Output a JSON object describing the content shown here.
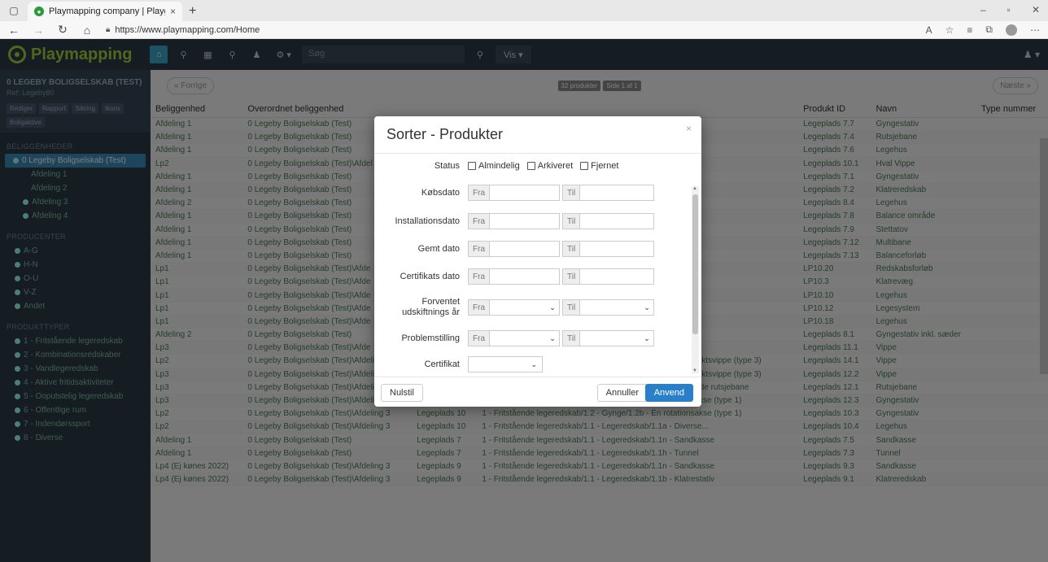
{
  "browser": {
    "tab_title": "Playmapping company | Playgro",
    "tab_close": "×",
    "new_tab": "+",
    "url": "https://www.playmapping.com/Home"
  },
  "app": {
    "logo": "Playmapping",
    "search_placeholder": "Søg",
    "vis_label": "Vis ▾"
  },
  "sidebar": {
    "company_name": "0 LEGEBY BOLIGSELSKAB (TEST)",
    "company_ref": "Ref: Legeby80",
    "buttons": [
      "Rediger",
      "Rapport",
      "Sikring",
      "Ikons",
      "Boligaktive"
    ],
    "sections": {
      "beliggenhed": "BELIGGENHEDER",
      "producenter": "PRODUCENTER",
      "produkttyper": "PRODUKTTYPER"
    },
    "locations": [
      "0 Legeby Boligselskab (Test)",
      "Afdeling 1",
      "Afdeling 2",
      "Afdeling 3",
      "Afdeling 4"
    ],
    "producers": [
      "A-G",
      "H-N",
      "O-U",
      "V-Z",
      "Andet"
    ],
    "product_types": [
      "1 - Fritstående legeredskab",
      "2 - Kombinationsredskaber",
      "3 - Vandlegeredskab",
      "4 - Aktive fritidsaktiviteter",
      "5 - Ooputstelig legeredskab",
      "6 - Offentlige rum",
      "7 - Indendørssport",
      "8 - Diverse"
    ]
  },
  "pager": {
    "prev": "« Forrige",
    "next": "Næste »",
    "badge_count": "32 produkter",
    "badge_page": "Side 1 af 1"
  },
  "table": {
    "headers": [
      "Beliggenhed",
      "Overordnet beliggenhed",
      "",
      "",
      "Produkt ID",
      "Navn",
      "Type nummer"
    ],
    "rows": [
      [
        "Afdeling 1",
        "0 Legeby Boligselskab (Test)",
        "",
        "rotationsakse (type 1)",
        "Legeplads 7.7",
        "Gyngestativ",
        ""
      ],
      [
        "Afdeling 1",
        "0 Legeby Boligselskab (Test)",
        "",
        "Tentamrutsjebane",
        "Legeplads 7.4",
        "Rutsjebane",
        ""
      ],
      [
        "Afdeling 1",
        "0 Legeby Boligselskab (Test)",
        "",
        "- Diverse...",
        "Legeplads 7.6",
        "Legehus",
        ""
      ],
      [
        "Lp2",
        "0 Legeby Boligselskab (Test)\\Afdel",
        "",
        "c - Etpunktsvippe (type 2)",
        "Legeplads 10.1",
        "Hval Vippe",
        ""
      ],
      [
        "Afdeling 1",
        "0 Legeby Boligselskab (Test)",
        "",
        "rotationsakse (type 1)",
        "Legeplads 7.1",
        "Gyngestativ",
        ""
      ],
      [
        "Afdeling 1",
        "0 Legeby Boligselskab (Test)",
        "",
        "- Klatrestativ",
        "Legeplads 7.2",
        "Klatreredskab",
        ""
      ],
      [
        "Afdeling 2",
        "0 Legeby Boligselskab (Test)",
        "",
        "- Diverse...",
        "Legeplads 8.4",
        "Legehus",
        ""
      ],
      [
        "Afdeling 1",
        "0 Legeby Boligselskab (Test)",
        "",
        "- Balanceredskab",
        "Legeplads 7.8",
        "Balance område",
        ""
      ],
      [
        "Afdeling 1",
        "0 Legeby Boligselskab (Test)",
        "",
        "",
        "Legeplads 7.9",
        "Stettatov",
        ""
      ],
      [
        "Afdeling 1",
        "0 Legeby Boligselskab (Test)",
        "",
        "ebane",
        "Legeplads 7.12",
        "Multibane",
        ""
      ],
      [
        "Afdeling 1",
        "0 Legeby Boligselskab (Test)",
        "",
        "",
        "Legeplads 7.13",
        "Balanceforløb",
        ""
      ],
      [
        "Lp1",
        "0 Legeby Boligselskab (Test)\\Afde",
        "",
        "",
        "LP10.20",
        "Redskabsforløb",
        ""
      ],
      [
        "Lp1",
        "0 Legeby Boligselskab (Test)\\Afde",
        "",
        "- Klatrevæg",
        "LP10.3",
        "Klatrevæg",
        ""
      ],
      [
        "Lp1",
        "0 Legeby Boligselskab (Test)\\Afde",
        "",
        "- Diverse...",
        "LP10.10",
        "Legehus",
        ""
      ],
      [
        "Lp1",
        "0 Legeby Boligselskab (Test)\\Afde",
        "",
        "",
        "LP10.12",
        "Legesystem",
        ""
      ],
      [
        "Lp1",
        "0 Legeby Boligselskab (Test)\\Afde",
        "",
        "- Diverse...",
        "LP10.18",
        "Legehus",
        ""
      ],
      [
        "Afdeling 2",
        "0 Legeby Boligselskab (Test)",
        "",
        "",
        "Legeplads 8.1",
        "Gyngestativ inkl. sæder",
        ""
      ],
      [
        "Lp3",
        "0 Legeby Boligselskab (Test)\\Afde",
        "",
        "- Etpunktsvippe (type 2)",
        "Legeplads 11.1",
        "Vippe",
        ""
      ],
      [
        "Lp2",
        "0 Legeby Boligselskab (Test)\\Afdeling 4",
        "Legeplads 14",
        "1 - Fritstående legeredskab/1.6 - Vippeedskab/1.6d - Flerpunktsvippe (type 3)",
        "Legeplads 14.1",
        "Vippe",
        ""
      ],
      [
        "Lp3",
        "0 Legeby Boligselskab (Test)\\Afdeling 4",
        "Legeplads 12",
        "1 - Fritstående legeredskab/1.6 - Vippeedskab/1.6d - Flerpunktsvippe (type 3)",
        "Legeplads 12.2",
        "Vippe",
        ""
      ],
      [
        "Lp3",
        "0 Legeby Boligselskab (Test)\\Afdeling 4",
        "Legeplads 12",
        "1 - Fritstående legeredskab/1.3 - Rutsjebane/1.3c - Fritstående rutsjebane",
        "Legeplads 12.1",
        "Rutsjebane",
        ""
      ],
      [
        "Lp3",
        "0 Legeby Boligselskab (Test)\\Afdeling 4",
        "Legeplads 12",
        "1 - Fritstående legeredskab/1.2 - Gynge/1.2b - Én rotationsakse (type 1)",
        "Legeplads 12.3",
        "Gyngestativ",
        ""
      ],
      [
        "Lp2",
        "0 Legeby Boligselskab (Test)\\Afdeling 3",
        "Legeplads 10",
        "1 - Fritstående legeredskab/1.2 - Gynge/1.2b - Én rotationsakse (type 1)",
        "Legeplads 10.3",
        "Gyngestativ",
        ""
      ],
      [
        "Lp2",
        "0 Legeby Boligselskab (Test)\\Afdeling 3",
        "Legeplads 10",
        "1 - Fritstående legeredskab/1.1 - Legeredskab/1.1a - Diverse...",
        "Legeplads 10.4",
        "Legehus",
        ""
      ],
      [
        "Afdeling 1",
        "0 Legeby Boligselskab (Test)",
        "Legeplads 7",
        "1 - Fritstående legeredskab/1.1 - Legeredskab/1.1n - Sandkasse",
        "Legeplads 7.5",
        "Sandkasse",
        ""
      ],
      [
        "Afdeling 1",
        "0 Legeby Boligselskab (Test)",
        "Legeplads 7",
        "1 - Fritstående legeredskab/1.1 - Legeredskab/1.1h - Tunnel",
        "Legeplads 7.3",
        "Tunnel",
        ""
      ],
      [
        "Lp4 (Ej kønes 2022)",
        "0 Legeby Boligselskab (Test)\\Afdeling 3",
        "Legeplads 9",
        "1 - Fritstående legeredskab/1.1 - Legeredskab/1.1n - Sandkasse",
        "Legeplads 9.3",
        "Sandkasse",
        ""
      ],
      [
        "Lp4 (Ej kønes 2022)",
        "0 Legeby Boligselskab (Test)\\Afdeling 3",
        "Legeplads 9",
        "1 - Fritstående legeredskab/1.1 - Legeredskab/1.1b - Klatrestativ",
        "Legeplads 9.1",
        "Klatreredskab",
        ""
      ]
    ]
  },
  "modal": {
    "title": "Sorter - Produkter",
    "close": "×",
    "status_label": "Status",
    "status_options": [
      "Almindelig",
      "Arkiveret",
      "Fjernet"
    ],
    "date_rows": [
      {
        "label": "Købsdato",
        "type": "date"
      },
      {
        "label": "Installationsdato",
        "type": "date"
      },
      {
        "label": "Gemt dato",
        "type": "date"
      },
      {
        "label": "Certifikats dato",
        "type": "date"
      }
    ],
    "select_rows": [
      {
        "label": "Forventet udskiftnings år"
      },
      {
        "label": "Problemstilling"
      }
    ],
    "from": "Fra",
    "to": "Til",
    "certificate_label": "Certifikat",
    "reset": "Nulstil",
    "cancel": "Annuller",
    "apply": "Anvend"
  }
}
